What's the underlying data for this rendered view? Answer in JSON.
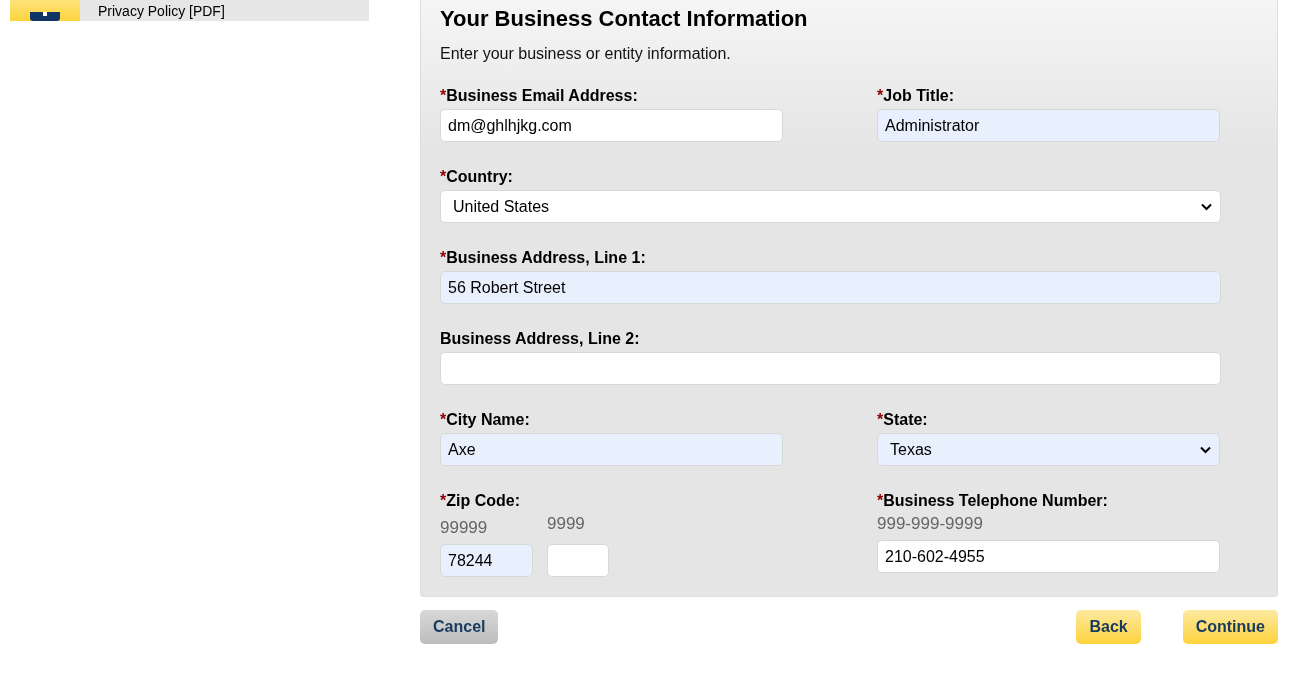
{
  "sidebar": {
    "items": [
      {
        "label": "Privacy Policy [PDF]"
      }
    ]
  },
  "form": {
    "title": "Your Business Contact Information",
    "subtitle": "Enter your business or entity information.",
    "rows": [
      {
        "fields": [
          {
            "kind": "text",
            "marker": "*",
            "label": "Business Email Address:",
            "value": "dm@ghlhjkg.com",
            "autofilled": false
          },
          {
            "kind": "text",
            "marker": "*",
            "label": "Job Title:",
            "value": "Administrator",
            "autofilled": true
          }
        ]
      },
      {
        "fields": [
          {
            "kind": "select",
            "marker": "*",
            "label": "Country:",
            "value": "United States",
            "autofilled": false,
            "full": true
          }
        ]
      },
      {
        "fields": [
          {
            "kind": "text",
            "marker": "*",
            "label": "Business Address, Line 1:",
            "value": "56 Robert Street",
            "autofilled": true,
            "full": true
          }
        ]
      },
      {
        "fields": [
          {
            "kind": "text",
            "label": "Business Address, Line 2:",
            "autofilled": false,
            "full": true
          }
        ]
      },
      {
        "fields": [
          {
            "kind": "text",
            "marker": "*",
            "label": "City Name:",
            "value": "Axe",
            "autofilled": true
          },
          {
            "kind": "select",
            "marker": "*",
            "label": "State:",
            "value": "Texas",
            "autofilled": true
          }
        ]
      },
      {
        "fields": [
          {
            "kind": "zip",
            "marker": "*",
            "label": "Zip Code:",
            "parts": [
              {
                "hint": "99999",
                "value": "78244",
                "autofilled": true
              },
              {
                "hint": "9999",
                "autofilled": false
              }
            ]
          },
          {
            "kind": "text",
            "marker": "*",
            "label": "Business Telephone Number:",
            "hint": "999-999-9999",
            "value": "210-602-4955",
            "autofilled": false
          }
        ]
      }
    ]
  },
  "buttons": [
    {
      "label": "Cancel",
      "kind": "secondary"
    },
    {
      "label": "Back",
      "kind": "primary"
    },
    {
      "label": "Continue",
      "kind": "primary"
    }
  ]
}
